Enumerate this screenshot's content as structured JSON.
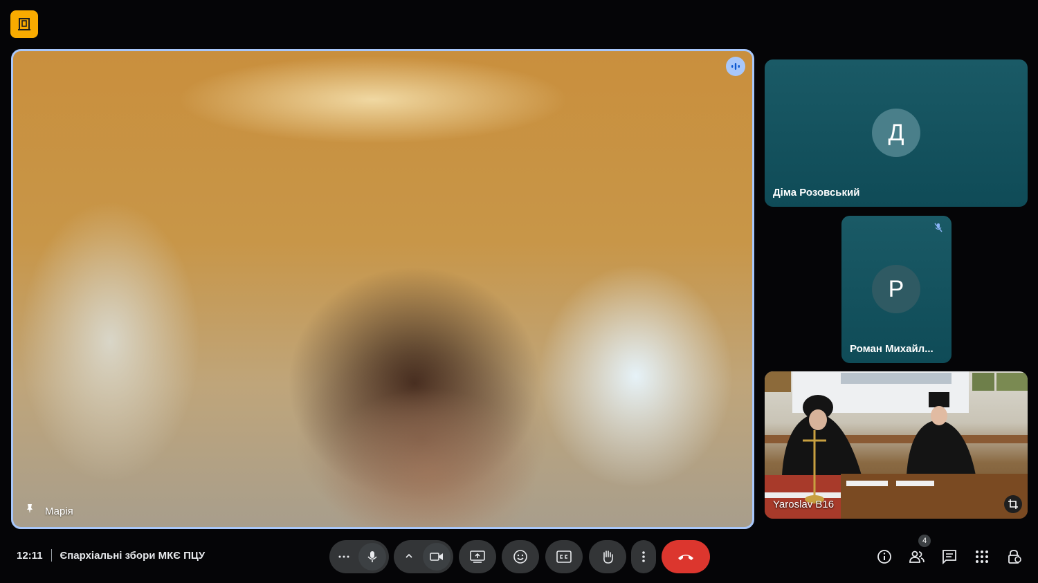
{
  "main_participant": {
    "name": "Марія"
  },
  "participants": [
    {
      "name": "Діма Розовський",
      "initial": "Д",
      "avatar_color": "#4a7f8a"
    },
    {
      "name": "Роман Михайл...",
      "initial": "Р",
      "avatar_color": "#2f5a63"
    },
    {
      "name": "Yaroslav B16"
    }
  ],
  "meeting": {
    "time": "12:11",
    "title": "Єпархіальні збори МКЄ ПЦУ"
  },
  "controls": {
    "more_options": "more-options-icon",
    "mic": "microphone-icon",
    "camera_options": "chevron-up-icon",
    "camera": "camera-icon",
    "present": "present-screen-icon",
    "reactions": "emoji-icon",
    "captions": "captions-icon",
    "raise_hand": "raise-hand-icon",
    "more": "more-vert-icon",
    "end_call": "end-call-icon"
  },
  "right_controls": {
    "people_count": "4"
  },
  "colors": {
    "accent": "#a8c7fa",
    "end_call": "#dc362e",
    "logo": "#f9ab00",
    "tile": "#0f4b57"
  }
}
